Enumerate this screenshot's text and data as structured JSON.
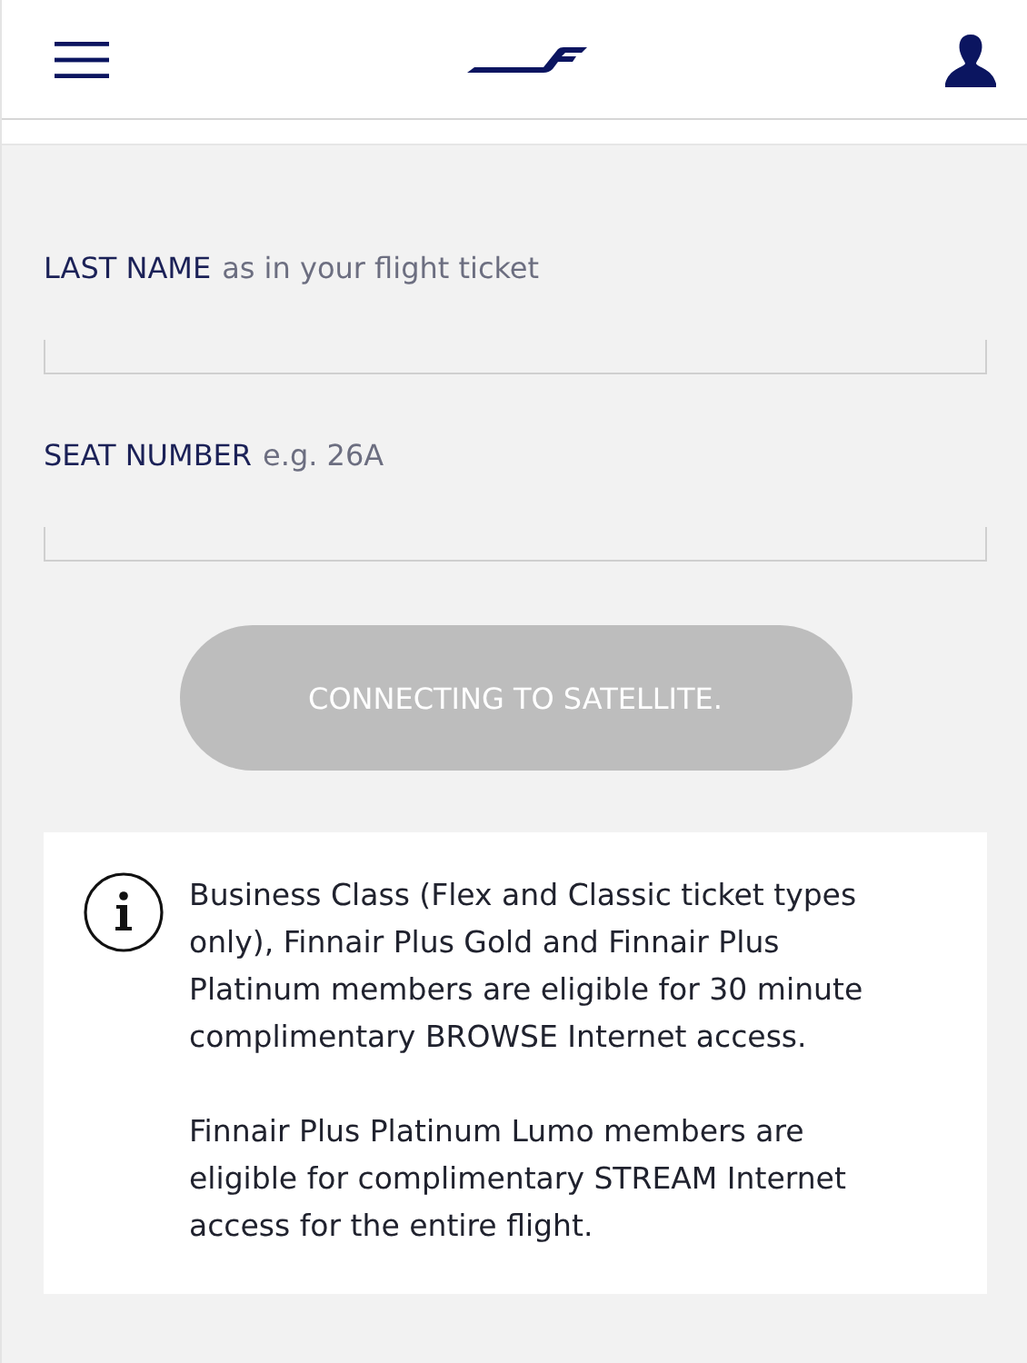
{
  "fields": [
    {
      "label": "LAST NAME",
      "hint": "as in your flight ticket"
    },
    {
      "label": "SEAT NUMBER",
      "hint": "e.g. 26A"
    }
  ],
  "button": {
    "label": "CONNECTING TO SATELLITE.",
    "disabled": true
  },
  "info": {
    "paragraphs": [
      "Business Class (Flex and Classic ticket types only), Finnair Plus Gold and Finnair Plus Platinum members are eligible for 30 minute complimentary BROWSE Internet access.",
      "Finnair Plus Platinum Lumo members are eligible for complimentary STREAM Internet access for the entire flight."
    ]
  }
}
